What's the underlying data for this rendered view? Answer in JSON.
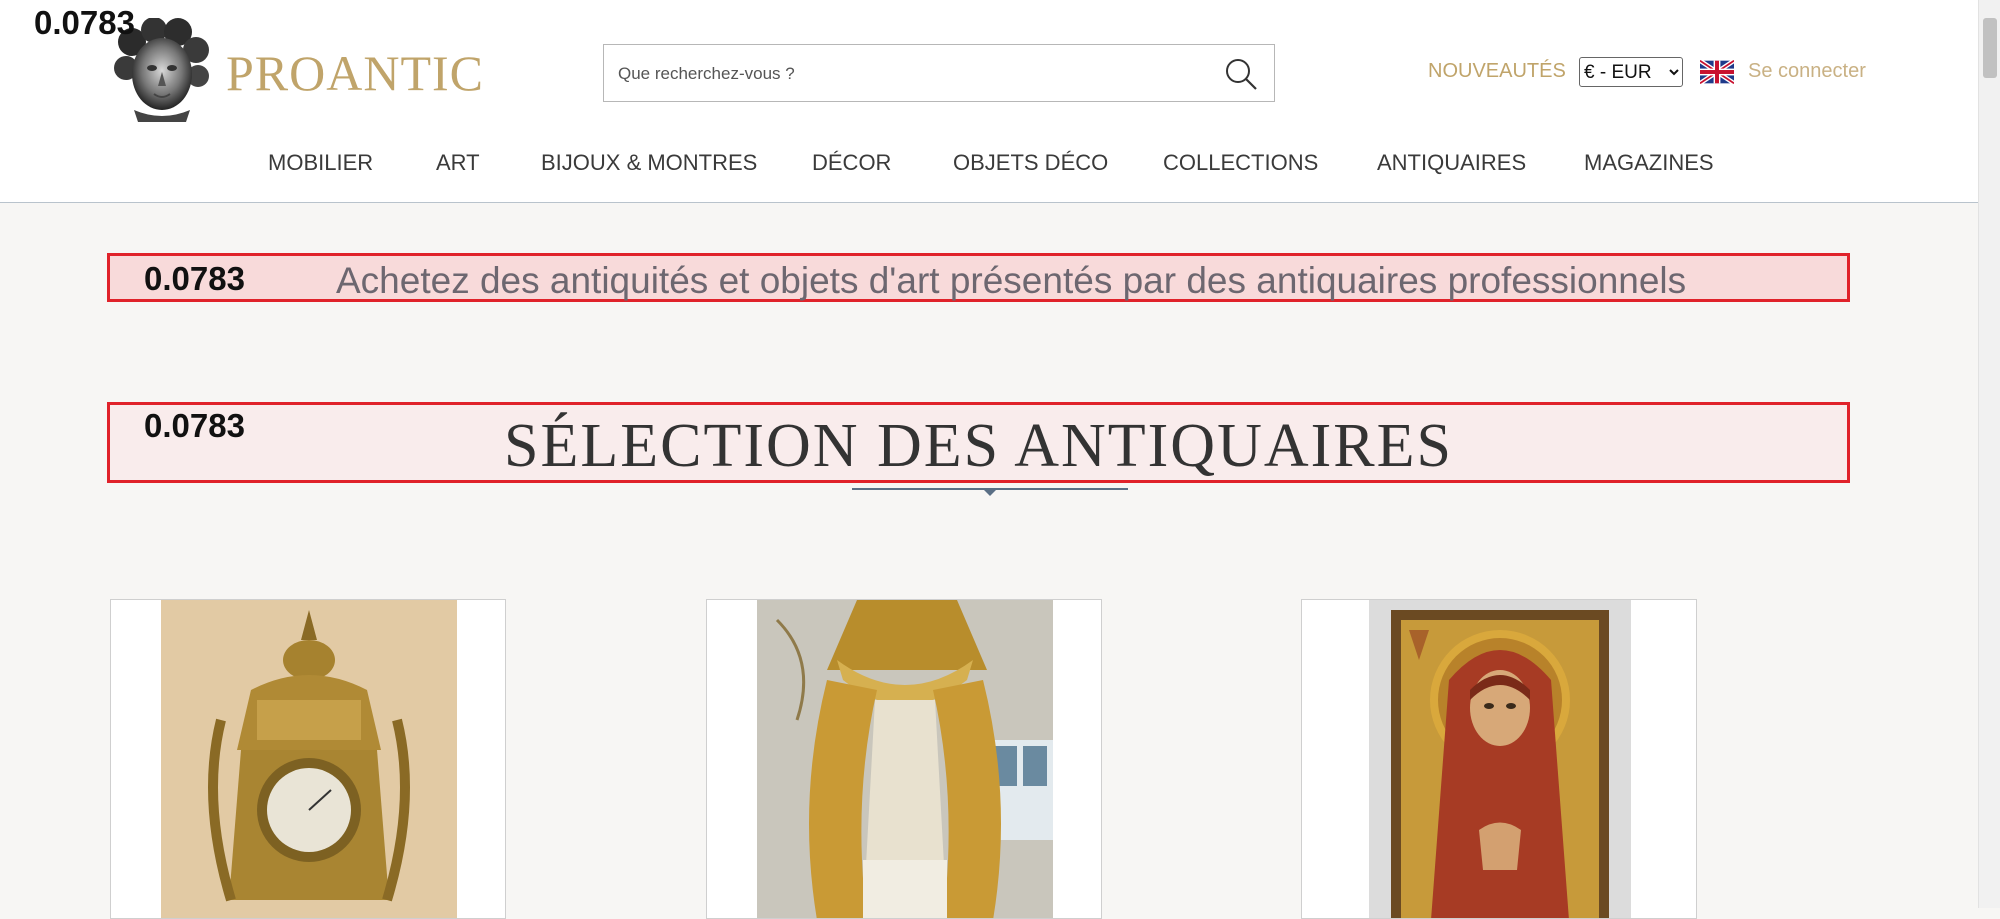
{
  "overlay_score": "0.0783",
  "logo": {
    "text": "PROANTIC"
  },
  "search": {
    "placeholder": "Que recherchez-vous ?"
  },
  "header": {
    "nouveautes": "NOUVEAUTÉS",
    "currency": {
      "selected": "€ - EUR"
    },
    "login": "Se connecter"
  },
  "nav": [
    "MOBILIER",
    "ART",
    "BIJOUX & MONTRES",
    "DÉCOR",
    "OBJETS DÉCO",
    "COLLECTIONS",
    "ANTIQUAIRES",
    "MAGAZINES"
  ],
  "banner": {
    "score": "0.0783",
    "text": "Achetez des antiquités et objets d'art présentés par des antiquaires professionnels"
  },
  "section": {
    "score": "0.0783",
    "title": "SÉLECTION DES ANTIQUAIRES"
  },
  "colors": {
    "gold": "#c0a46a",
    "highlight_border": "#e0222a",
    "accent_line": "#5a6f85"
  },
  "icons": {
    "search": "search-icon",
    "flag": "uk-flag-icon"
  }
}
